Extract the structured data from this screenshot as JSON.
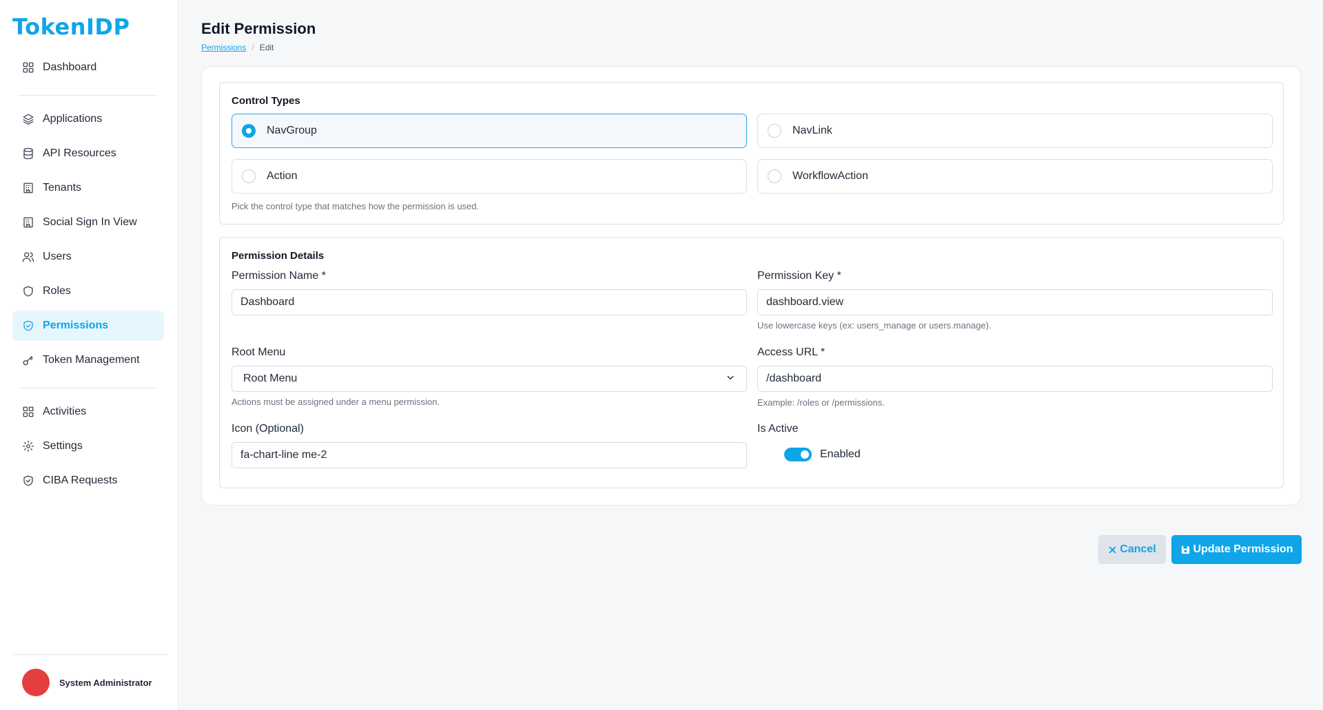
{
  "brand": {
    "logo_text": "TokenIDP"
  },
  "sidebar": {
    "items": [
      {
        "label": "Dashboard",
        "icon": "grid-icon"
      },
      {
        "label": "Applications",
        "icon": "layers-icon"
      },
      {
        "label": "API Resources",
        "icon": "database-icon"
      },
      {
        "label": "Tenants",
        "icon": "building-icon"
      },
      {
        "label": "Social Sign In View",
        "icon": "building-icon"
      },
      {
        "label": "Users",
        "icon": "users-icon"
      },
      {
        "label": "Roles",
        "icon": "shield-icon"
      },
      {
        "label": "Permissions",
        "icon": "shield-check-icon",
        "active": true
      },
      {
        "label": "Token Management",
        "icon": "key-icon"
      },
      {
        "label": "Activities",
        "icon": "grid-icon"
      },
      {
        "label": "Settings",
        "icon": "gear-icon"
      },
      {
        "label": "CIBA Requests",
        "icon": "shield-check-icon"
      }
    ],
    "user": {
      "name": "System Administrator"
    }
  },
  "page": {
    "title": "Edit Permission",
    "breadcrumb": {
      "parent": "Permissions",
      "current": "Edit",
      "separator": "/"
    }
  },
  "control_types": {
    "title": "Control Types",
    "options": [
      {
        "label": "NavGroup",
        "selected": true
      },
      {
        "label": "NavLink",
        "selected": false
      },
      {
        "label": "Action",
        "selected": false
      },
      {
        "label": "WorkflowAction",
        "selected": false
      }
    ],
    "help": "Pick the control type that matches how the permission is used."
  },
  "details": {
    "title": "Permission Details",
    "permission_name": {
      "label": "Permission Name *",
      "value": "Dashboard"
    },
    "permission_key": {
      "label": "Permission Key *",
      "value": "dashboard.view",
      "help": "Use lowercase keys (ex: users_manage or users.manage)."
    },
    "root_menu": {
      "label": "Root Menu",
      "value": "Root Menu",
      "help": "Actions must be assigned under a menu permission."
    },
    "access_url": {
      "label": "Access URL *",
      "value": "/dashboard",
      "help": "Example: /roles or /permissions."
    },
    "icon": {
      "label": "Icon (Optional)",
      "value": "fa-chart-line me-2"
    },
    "is_active": {
      "label": "Is Active",
      "toggle_label": "Enabled",
      "enabled": true
    }
  },
  "actions": {
    "cancel_label": "Cancel",
    "update_label": "Update Permission"
  },
  "colors": {
    "accent": "#0ea5e9",
    "avatar": "#e53e3e"
  }
}
